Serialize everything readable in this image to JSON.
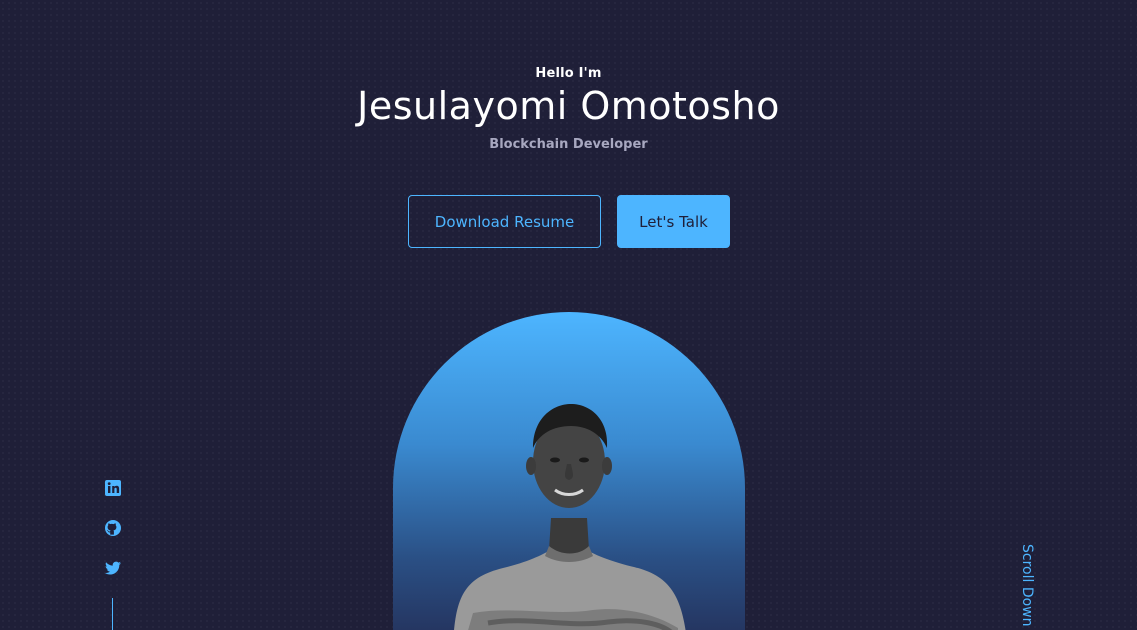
{
  "header": {
    "greeting": "Hello I'm",
    "name": "Jesulayomi Omotosho",
    "role": "Blockchain Developer"
  },
  "cta": {
    "download_label": "Download Resume",
    "talk_label": "Let's Talk"
  },
  "socials": [
    {
      "icon": "linkedin-icon",
      "label": "LinkedIn"
    },
    {
      "icon": "github-icon",
      "label": "GitHub"
    },
    {
      "icon": "twitter-icon",
      "label": "Twitter"
    }
  ],
  "scroll": {
    "label": "Scroll Down"
  },
  "colors": {
    "background": "#1f1f38",
    "accent": "#4db5ff",
    "text": "#ffffff",
    "muted": "#a8a8c0"
  }
}
